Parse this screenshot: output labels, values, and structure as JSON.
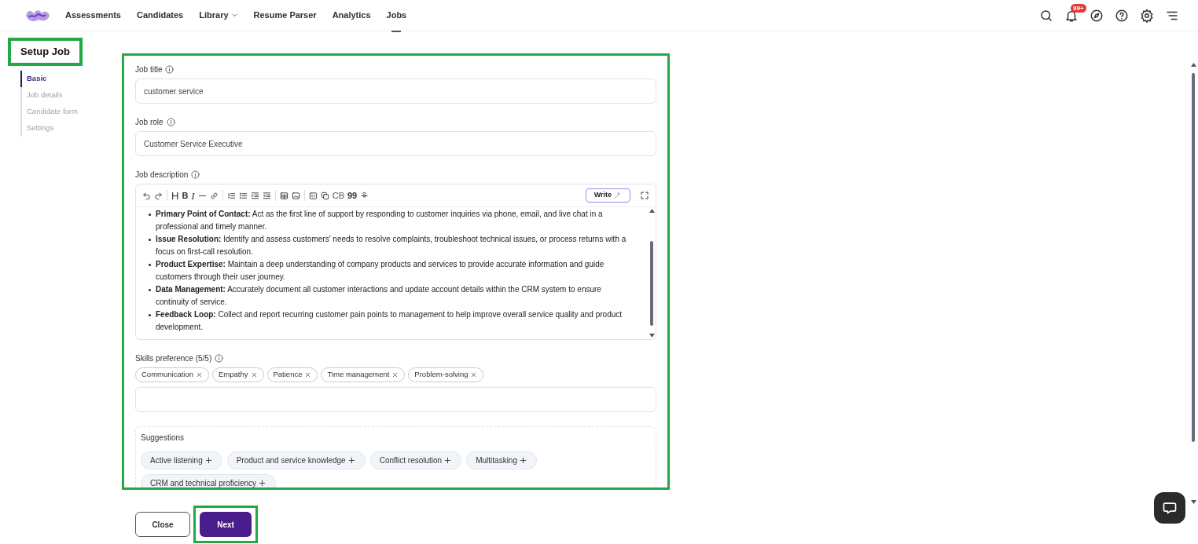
{
  "nav": {
    "items": [
      {
        "label": "Assessments",
        "selected": false,
        "dropdown": false
      },
      {
        "label": "Candidates",
        "selected": false,
        "dropdown": false
      },
      {
        "label": "Library",
        "selected": false,
        "dropdown": true
      },
      {
        "label": "Resume Parser",
        "selected": false,
        "dropdown": false
      },
      {
        "label": "Analytics",
        "selected": false,
        "dropdown": false
      },
      {
        "label": "Jobs",
        "selected": true,
        "dropdown": false
      }
    ],
    "notification_badge": "99+"
  },
  "sidebar": {
    "title": "Setup Job",
    "highlighted": true,
    "steps": [
      {
        "label": "Basic",
        "selected": true
      },
      {
        "label": "Job details",
        "selected": false
      },
      {
        "label": "Candidate form",
        "selected": false
      },
      {
        "label": "Settings",
        "selected": false
      }
    ]
  },
  "form": {
    "highlighted": true,
    "job_title": {
      "label": "Job title",
      "value": "customer service"
    },
    "job_role": {
      "label": "Job role",
      "value": "Customer Service Executive"
    },
    "job_description": {
      "label": "Job description",
      "toolbar_text": {
        "heading": "H",
        "bold": "B",
        "italic": "I",
        "code_block": "CB",
        "quote": "99"
      },
      "write_button": "Write",
      "bullets": [
        "**Primary Point of Contact:** Act as the first line of support by responding to customer inquiries via phone, email, and live chat in a professional and timely manner.",
        "**Issue Resolution:** Identify and assess customers' needs to resolve complaints, troubleshoot technical issues, or process returns with a focus on first-call resolution.",
        "**Product Expertise:** Maintain a deep understanding of company products and services to provide accurate information and guide customers through their user journey.",
        "**Data Management:** Accurately document all customer interactions and update account details within the CRM system to ensure continuity of service.",
        "**Feedback Loop:** Collect and report recurring customer pain points to management to help improve overall service quality and product development."
      ]
    },
    "skills": {
      "label": "Skills preference (5/5)",
      "tags": [
        "Communication",
        "Empathy",
        "Patience",
        "Time management",
        "Problem-solving"
      ]
    },
    "suggestions": {
      "title": "Suggestions",
      "items": [
        "Active listening",
        "Product and service knowledge",
        "Conflict resolution",
        "Multitasking",
        "CRM and technical proficiency"
      ]
    }
  },
  "buttons": {
    "close": "Close",
    "next": {
      "label": "Next",
      "highlighted": true
    }
  }
}
